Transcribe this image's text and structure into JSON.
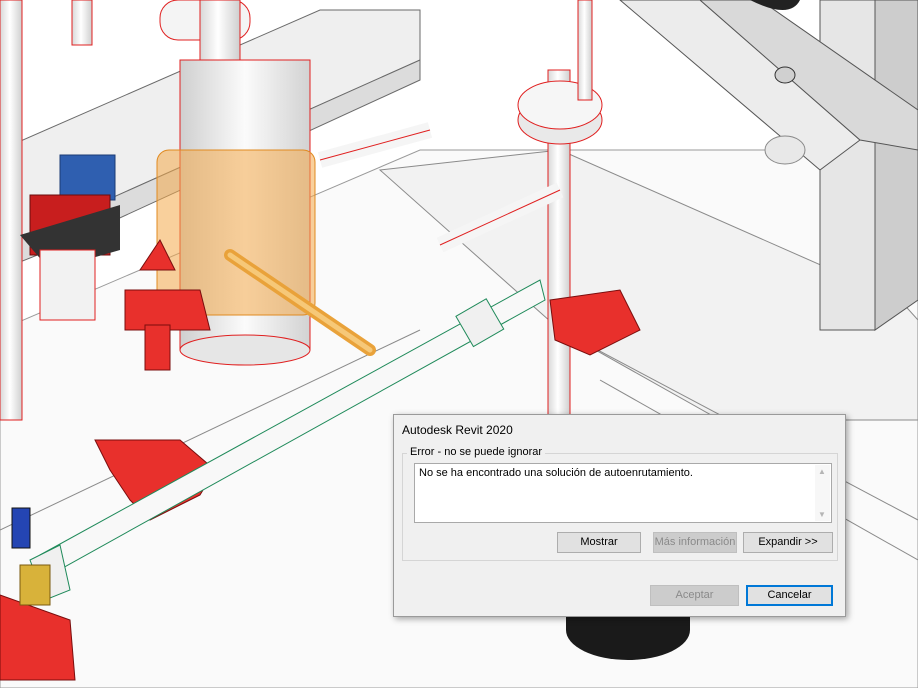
{
  "dialog": {
    "title": "Autodesk Revit 2020",
    "group_label": "Error - no se puede ignorar",
    "message": "No se ha encontrado una solución de autoenrutamiento.",
    "buttons": {
      "show": "Mostrar",
      "more_info": "Más información",
      "expand": "Expandir >>",
      "accept": "Aceptar",
      "cancel": "Cancelar"
    },
    "states": {
      "more_info_enabled": false,
      "accept_enabled": false,
      "default_button": "cancel"
    }
  },
  "colors": {
    "selection_red": "#e02020",
    "valve_red": "#e8302c",
    "route_green": "#1f8a5a",
    "highlight_orange": "#f4a94a",
    "pipe_white": "#f4f4f4",
    "accent_blue": "#0078d7"
  },
  "icons": {
    "scroll_up": "▲",
    "scroll_down": "▼"
  }
}
